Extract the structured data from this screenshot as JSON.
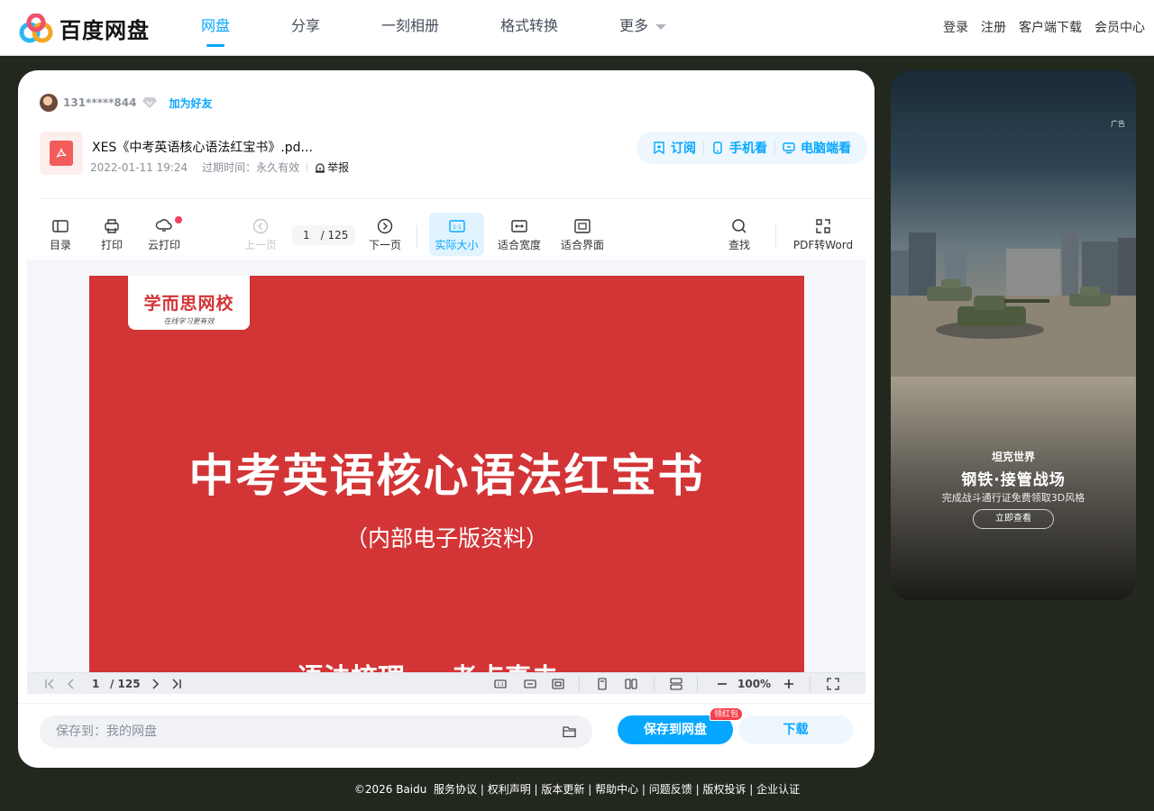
{
  "header": {
    "logo_text": "百度网盘",
    "nav": [
      {
        "label": "网盘"
      },
      {
        "label": "分享"
      },
      {
        "label": "一刻相册"
      },
      {
        "label": "格式转换"
      },
      {
        "label": "更多"
      }
    ],
    "links": [
      "登录",
      "注册",
      "客户端下载",
      "会员中心"
    ]
  },
  "sharer": {
    "name": "131*****844",
    "add_friend": "加为好友"
  },
  "file": {
    "name": "XES《中考英语核心语法红宝书》.pd...",
    "date": "2022-01-11 19:24",
    "expire": "过期时间：永久有效",
    "report": "举报",
    "actions": [
      "订阅",
      "手机看",
      "电脑端看"
    ]
  },
  "toolbar": {
    "toc": "目录",
    "print": "打印",
    "cloud_print": "云打印",
    "prev": "上一页",
    "current_page": "1",
    "total_pages": "/ 125",
    "next": "下一页",
    "actual_size": "实际大小",
    "fit_width": "适合宽度",
    "fit_page": "适合界面",
    "search": "查找",
    "pdf_to_word": "PDF转Word"
  },
  "slide": {
    "logo_main": "学而思网校",
    "logo_sub": "在线学习更有效",
    "title": "中考英语核心语法红宝书",
    "subtitle": "（内部电子版资料）",
    "bottom": "语法梳理  考点真击"
  },
  "preview_bar": {
    "page": "1",
    "total": "/ 125",
    "zoom": "100%"
  },
  "save": {
    "path": "保存到：我的网盘",
    "save_button": "保存到网盘",
    "badge": "领红包",
    "download": "下载"
  },
  "ad": {
    "tag": "广告",
    "brand": "坦克世界",
    "title": "钢铁·接管战场",
    "desc": "完成战斗通行证免费领取3D风格",
    "cta": "立即查看"
  },
  "footer": {
    "copyright": "©2026 Baidu",
    "links": [
      "服务协议",
      "权利声明",
      "版本更新",
      "帮助中心",
      "问题反馈",
      "版权投诉",
      "企业认证"
    ]
  },
  "colors": {
    "accent": "#06a7ff",
    "page_bg": "#23281f",
    "slide_red": "#d33435",
    "badge_red": "#f5404d"
  }
}
